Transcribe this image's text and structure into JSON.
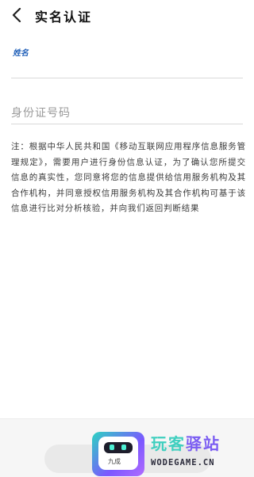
{
  "header": {
    "back_icon": "chevron-left-icon",
    "title": "实名认证"
  },
  "form": {
    "name_label": "姓名",
    "name_value": "",
    "id_placeholder": "身份证号码",
    "id_value": ""
  },
  "notice": {
    "text": "注：根据中华人民共和国《移动互联网应用程序信息服务管理规定》，需要用户进行身份信息认证，为了确认您所提交信息的真实性，您同意将您的信息提供给信用服务机构及其合作机构，并同意授权信用服务机构及其合作机构可基于该信息进行比对分析核验，并向我们返回判断结果"
  },
  "footer": {
    "submit_label": ""
  },
  "watermark": {
    "stamp": "九成",
    "brand_part1": "玩客",
    "brand_part2": "驿站",
    "domain": "WODEGAME.CN"
  }
}
